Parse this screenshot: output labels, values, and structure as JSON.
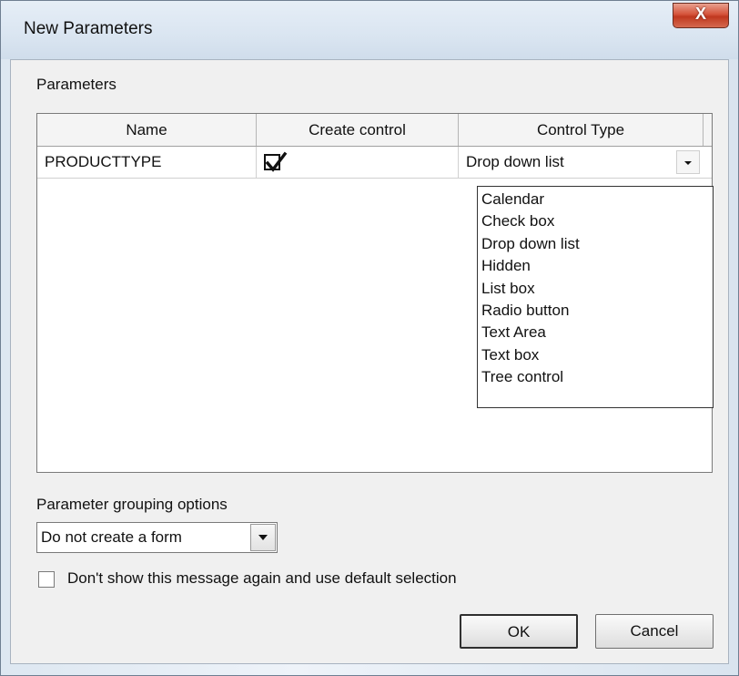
{
  "window": {
    "title": "New Parameters",
    "close_glyph": "X"
  },
  "parameters_group": {
    "label": "Parameters"
  },
  "grid": {
    "columns": [
      "Name",
      "Create control",
      "Control Type"
    ],
    "rows": [
      {
        "name": "PRODUCTTYPE",
        "create_control": true,
        "control_type": "Drop down list"
      }
    ]
  },
  "control_type_options": [
    "Calendar",
    "Check box",
    "Drop down list",
    "Hidden",
    "List box",
    "Radio button",
    "Text Area",
    "Text box",
    "Tree control"
  ],
  "grouping": {
    "label": "Parameter grouping options",
    "selected": "Do not create a form"
  },
  "dont_show": {
    "label": "Don't show this message again and use default selection",
    "checked": false
  },
  "buttons": {
    "ok": "OK",
    "cancel": "Cancel"
  },
  "icons": {
    "check": "check-icon",
    "dropdown": "chevron-down-icon",
    "close": "close-icon"
  }
}
